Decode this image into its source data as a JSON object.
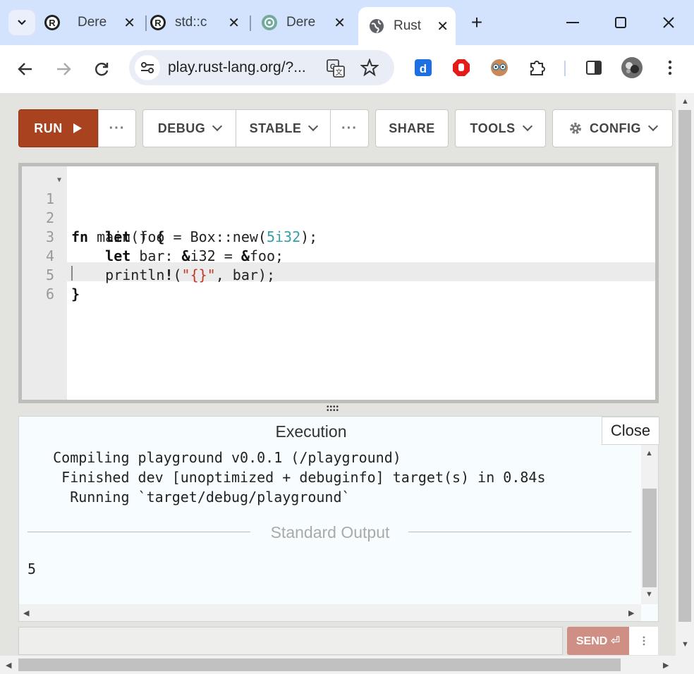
{
  "browser": {
    "tabs": [
      {
        "title": "Dere",
        "icon": "rust-icon"
      },
      {
        "title": "std::c",
        "icon": "rust-icon"
      },
      {
        "title": "Dere",
        "icon": "chatgpt-icon"
      },
      {
        "title": "Rust",
        "icon": "globe-icon",
        "active": true
      }
    ],
    "new_tab": "+",
    "url": "play.rust-lang.org/?...",
    "window_buttons": {
      "minimize": "—",
      "maximize": "☐",
      "close": "✕"
    }
  },
  "toolbar": {
    "run": "RUN",
    "more": "···",
    "debug": "DEBUG",
    "stable": "STABLE",
    "share": "SHARE",
    "tools": "TOOLS",
    "config": "CONFIG"
  },
  "editor": {
    "lines": [
      {
        "n": "1",
        "text": "fn main() {"
      },
      {
        "n": "2",
        "text": "    let foo = Box::new(5i32);"
      },
      {
        "n": "3",
        "text": "    let bar: &i32 = &foo;"
      },
      {
        "n": "4",
        "text": "    println!(\"{}\", bar);"
      },
      {
        "n": "5",
        "text": "}"
      },
      {
        "n": "6",
        "text": ""
      }
    ]
  },
  "output": {
    "title": "Execution",
    "close": "Close",
    "stderr": [
      "   Compiling playground v0.0.1 (/playground)",
      "    Finished dev [unoptimized + debuginfo] target(s) in 0.84s",
      "     Running `target/debug/playground`"
    ],
    "section": "Standard Output",
    "stdout": "5"
  },
  "stdin": {
    "send": "SEND ⏎"
  },
  "colors": {
    "run_button": "#a8421f",
    "send_button": "#d08f85",
    "titlebar": "#d3e3fd"
  }
}
